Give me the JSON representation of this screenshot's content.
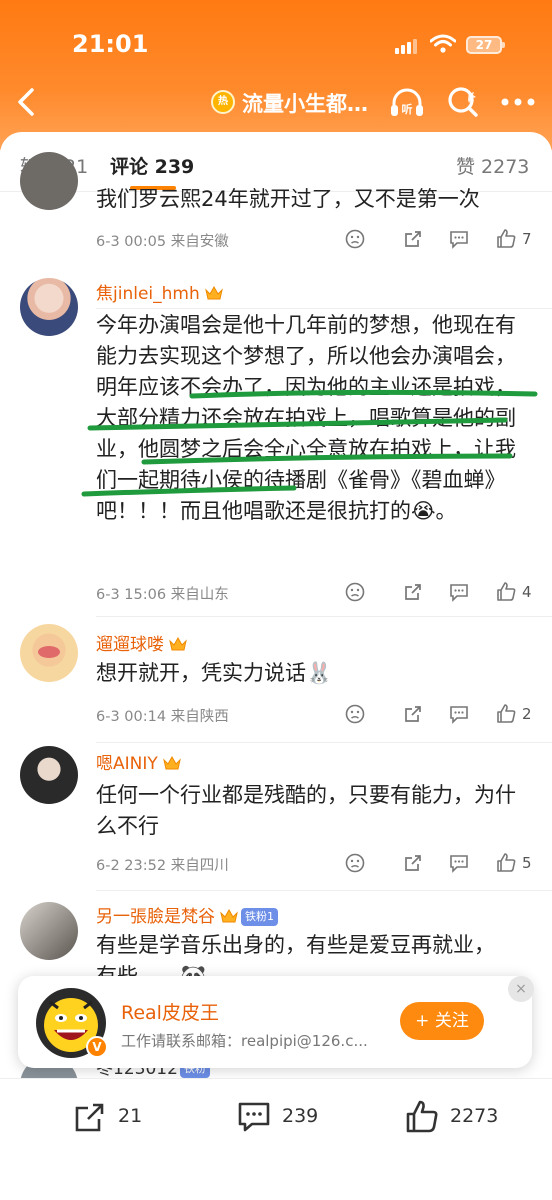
{
  "status_bar": {
    "time": "21:01",
    "battery": "27"
  },
  "nav": {
    "topic_badge": "热",
    "title": "流量小生都…",
    "listen_label": "听"
  },
  "tabs": [
    {
      "label": "转发 21"
    },
    {
      "label": "评论 239"
    },
    {
      "label": "赞 2273"
    }
  ],
  "comments": [
    {
      "username": "",
      "text": "我们罗云熙24年就开过了，又不是第一次",
      "time": "6-3 00:05",
      "location": "来自安徽",
      "likes": "7"
    },
    {
      "username": "焦jinlei_hmh",
      "text": "今年办演唱会是他十几年前的梦想，他现在有能力去实现这个梦想了，所以他会办演唱会，明年应该不会办了，因为他的主业还是拍戏，大部分精力还会放在拍戏上，唱歌算是他的副业，他圆梦之后会全心全意放在拍戏上，让我们一起期待小侯的待播剧《雀骨》《碧血蝉》吧！！！而且他唱歌还是很抗打的",
      "emoji": "😭",
      "end": "。",
      "time": "6-3 15:06",
      "location": "来自山东",
      "likes": "4"
    },
    {
      "username": "遛遛球喽",
      "text": "想开就开，凭实力说话",
      "emoji": "🐰",
      "time": "6-3 00:14",
      "location": "来自陕西",
      "likes": "2"
    },
    {
      "username": "嗯AINIY",
      "text": "任何一个行业都是残酷的，只要有能力，为什么不行",
      "time": "6-2 23:52",
      "location": "来自四川",
      "likes": "5"
    },
    {
      "username": "另一張臉是梵谷",
      "fan_badge": "铁粉1",
      "text": "有些是学音乐出身的，有些是爱豆再就业，有些……",
      "emoji": "🐼"
    },
    {
      "username": "冬123012",
      "fan_badge": "铁粉"
    }
  ],
  "follow_card": {
    "name": "Real皮皮王",
    "description": "工作请联系邮箱：realpipi@126.c...",
    "follow_label": "+ 关注",
    "close_label": "×"
  },
  "bottom_bar": {
    "reposts": "21",
    "comments": "239",
    "likes": "2273"
  },
  "colors": {
    "header_orange": "#ff7a12",
    "username_orange": "#e8620a",
    "follow_button": "#ff8a10",
    "annotation_ink": "#1f9a3c"
  }
}
